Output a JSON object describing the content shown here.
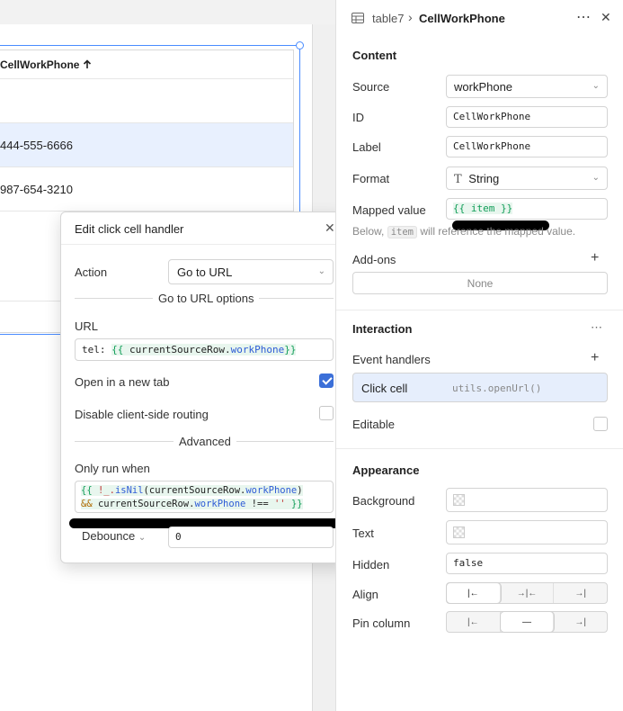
{
  "table": {
    "column_header": "CellWorkPhone",
    "sort_icon": "arrow-up",
    "rows": [
      "",
      "444-555-6666",
      "987-654-3210"
    ]
  },
  "modal": {
    "title": "Edit click cell handler",
    "action_label": "Action",
    "action_value": "Go to URL",
    "options_title": "Go to URL options",
    "url_label": "URL",
    "url_prefix": "tel: ",
    "url_open": "{{ ",
    "url_obj": "currentSourceRow",
    "url_dot": ".",
    "url_prop": "workPhone",
    "url_close": "}}",
    "open_new_tab_label": "Open in a new tab",
    "open_new_tab_checked": true,
    "disable_routing_label": "Disable client-side routing",
    "disable_routing_checked": false,
    "advanced_title": "Advanced",
    "only_run_label": "Only run when",
    "cond_l1_open": "{{ ",
    "cond_l1_not": "!_.",
    "cond_l1_fn": "isNil",
    "cond_l1_paren": "(",
    "cond_l1_obj": "currentSourceRow",
    "cond_l1_dot": ".",
    "cond_l1_prop": "workPhone",
    "cond_l1_close": ")",
    "cond_l2_and": "&& ",
    "cond_l2_obj": "currentSourceRow",
    "cond_l2_dot": ".",
    "cond_l2_prop": "workPhone",
    "cond_l2_op": " !== ",
    "cond_l2_str": "''",
    "cond_l2_close": " }}",
    "debounce_label": "Debounce",
    "debounce_value": "0"
  },
  "inspector": {
    "breadcrumb_parent": "table7",
    "breadcrumb_child": "CellWorkPhone",
    "content_title": "Content",
    "source_label": "Source",
    "source_value": "workPhone",
    "id_label": "ID",
    "id_value": "CellWorkPhone",
    "label_label": "Label",
    "label_value": "CellWorkPhone",
    "format_label": "Format",
    "format_value": "String",
    "mapped_label": "Mapped value",
    "mapped_value": "{{ item }}",
    "mapped_help_prefix": "Below, ",
    "mapped_help_code": "item",
    "mapped_help_suffix": " will reference the mapped value.",
    "addons_label": "Add-ons",
    "addons_value": "None",
    "interaction_title": "Interaction",
    "event_handlers_label": "Event handlers",
    "handler_name": "Click cell",
    "handler_code": "utils.openUrl()",
    "editable_label": "Editable",
    "appearance_title": "Appearance",
    "background_label": "Background",
    "text_label": "Text",
    "hidden_label": "Hidden",
    "hidden_value": "false",
    "align_label": "Align",
    "pin_label": "Pin column"
  },
  "colors": {
    "accent": "#3b6fd8",
    "selection": "#4a8cff",
    "code_green": "#119d58",
    "code_blue": "#2d5bd6"
  }
}
